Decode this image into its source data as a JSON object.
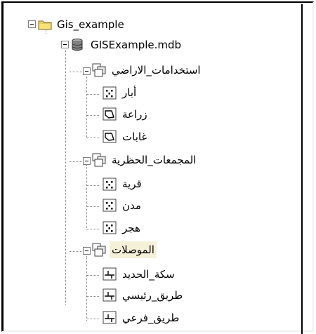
{
  "tree": {
    "root": {
      "label": "Gis_example",
      "icon": "folder-icon"
    },
    "database": {
      "label": "GISExample.mdb",
      "icon": "database-icon"
    },
    "datasets": [
      {
        "label": "استخدامات_الاراضي",
        "icon": "feature-dataset-icon",
        "classes": [
          {
            "label": "أبار",
            "icon": "point-feature-class-icon"
          },
          {
            "label": "زراعة",
            "icon": "polygon-feature-class-icon"
          },
          {
            "label": "غابات",
            "icon": "polygon-feature-class-icon"
          }
        ]
      },
      {
        "label": "المجمعات_الحظرية",
        "icon": "feature-dataset-icon",
        "classes": [
          {
            "label": "قرية",
            "icon": "point-feature-class-icon"
          },
          {
            "label": "مدن",
            "icon": "point-feature-class-icon"
          },
          {
            "label": "هجر",
            "icon": "point-feature-class-icon"
          }
        ]
      },
      {
        "label": "الموصلات",
        "icon": "feature-dataset-icon",
        "selected": true,
        "classes": [
          {
            "label": "سكة_الحديد",
            "icon": "line-feature-class-icon"
          },
          {
            "label": "طريق_رئيسي",
            "icon": "line-feature-class-icon"
          },
          {
            "label": "طريق_فرعي",
            "icon": "line-feature-class-icon"
          }
        ]
      }
    ]
  }
}
